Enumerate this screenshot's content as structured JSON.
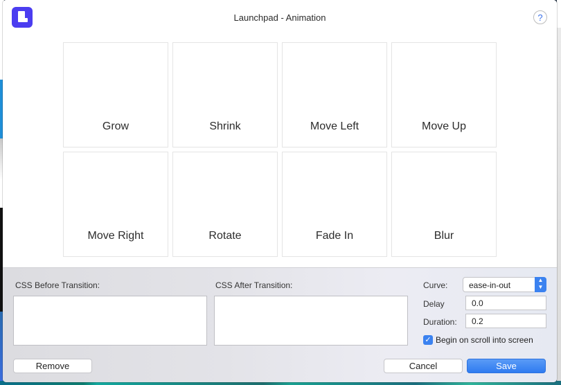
{
  "window": {
    "title": "Launchpad - Animation",
    "help_label": "?"
  },
  "animations": [
    {
      "label": "Grow"
    },
    {
      "label": "Shrink"
    },
    {
      "label": "Move Left"
    },
    {
      "label": "Move Up"
    },
    {
      "label": "Move Right"
    },
    {
      "label": "Rotate"
    },
    {
      "label": "Fade In"
    },
    {
      "label": "Blur"
    }
  ],
  "panel": {
    "css_before_label": "CSS Before Transition:",
    "css_before_value": "",
    "css_after_label": "CSS After Transition:",
    "css_after_value": "",
    "curve_label": "Curve:",
    "curve_value": "ease-in-out",
    "delay_label": "Delay",
    "delay_value": "0.0",
    "duration_label": "Duration:",
    "duration_value": "0.2",
    "scroll_checkbox_label": "Begin on scroll into screen",
    "scroll_checkbox_checked": true
  },
  "buttons": {
    "remove": "Remove",
    "cancel": "Cancel",
    "save": "Save"
  },
  "colors": {
    "accent": "#3b82f0",
    "logo": "#4b3df0"
  },
  "icons": {
    "logo": "launchpad-logo-icon",
    "help": "question-mark-icon",
    "select_stepper": "up-down-chevron-icon",
    "checkmark": "checkmark-icon"
  }
}
